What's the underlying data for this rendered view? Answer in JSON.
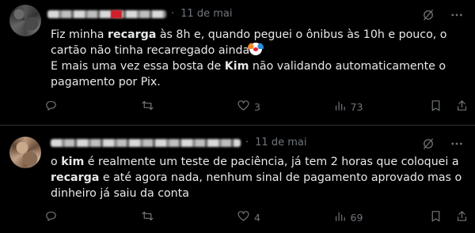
{
  "tweets": [
    {
      "date": "11 de mai",
      "segments": [
        {
          "t": "Fiz minha ",
          "b": false
        },
        {
          "t": "recarga",
          "b": true
        },
        {
          "t": " às 8h e, quando peguei o ônibus às 10h e pouco, o\ncartão não tinha recarregado ainda",
          "b": false
        },
        {
          "t": "\nE mais uma vez essa bosta de ",
          "b": false
        },
        {
          "t": "Kim",
          "b": true
        },
        {
          "t": " não validando automaticamente o\npagamento por Pix.",
          "b": false
        }
      ],
      "emoji_after_segment": 2,
      "emoji_icon": "clown-face-icon",
      "stats": {
        "replies": "",
        "retweets": "",
        "likes": "3",
        "views": "73"
      }
    },
    {
      "date": "11 de mai",
      "segments": [
        {
          "t": "o ",
          "b": false
        },
        {
          "t": "kim",
          "b": true
        },
        {
          "t": " é realmente um teste de paciência, já tem 2 horas que coloquei a\n",
          "b": false
        },
        {
          "t": "recarga",
          "b": true
        },
        {
          "t": " e até agora nada, nenhum sinal de pagamento aprovado mas o\ndinheiro já saiu da conta",
          "b": false
        }
      ],
      "stats": {
        "replies": "",
        "retweets": "",
        "likes": "4",
        "views": "69"
      }
    }
  ],
  "icons": {
    "top": [
      "grok-icon",
      "more-icon"
    ],
    "actions": [
      "reply-icon",
      "retweet-icon",
      "like-icon",
      "views-icon",
      "bookmark-icon",
      "share-icon"
    ]
  },
  "colors": {
    "background": "#000000",
    "text": "#e7e9ea",
    "muted": "#71767b",
    "divider": "#2f3336"
  }
}
